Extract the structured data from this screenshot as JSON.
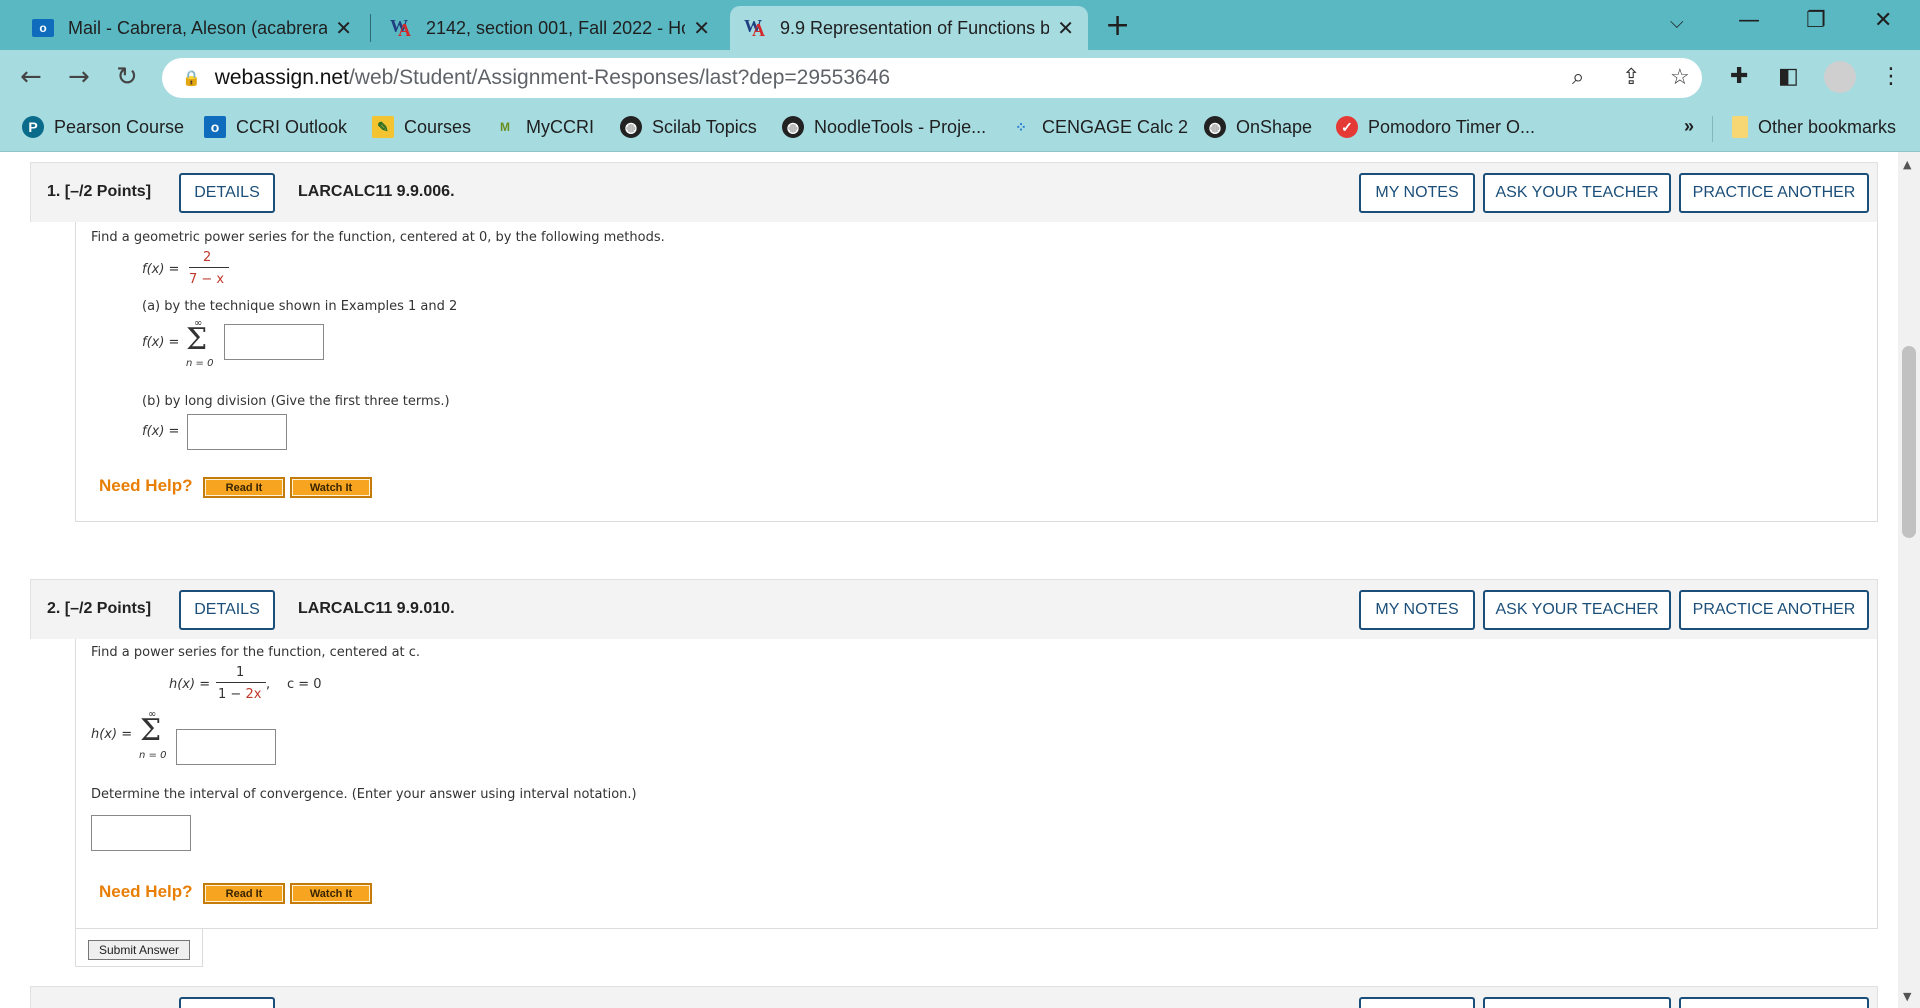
{
  "tabs": [
    {
      "title": "Mail - Cabrera, Aleson (acabrera",
      "icon": "outlook-icon"
    },
    {
      "title": "2142, section 001, Fall 2022 - Ho",
      "icon": "webassign-icon"
    },
    {
      "title": "9.9 Representation of Functions b",
      "icon": "webassign-icon",
      "active": true
    }
  ],
  "address": {
    "host": "webassign.net",
    "path": "/web/Student/Assignment-Responses/last?dep=29553646"
  },
  "bookmarks": [
    {
      "label": "Pearson Course",
      "icon": "pearson-icon"
    },
    {
      "label": "CCRI Outlook",
      "icon": "outlook-icon"
    },
    {
      "label": "Courses",
      "icon": "pencil-icon"
    },
    {
      "label": "MyCCRI",
      "icon": "myccri-icon"
    },
    {
      "label": "Scilab Topics",
      "icon": "globe-icon"
    },
    {
      "label": "NoodleTools - Proje...",
      "icon": "globe-icon"
    },
    {
      "label": "CENGAGE Calc 2",
      "icon": "cengage-icon"
    },
    {
      "label": "OnShape",
      "icon": "globe-icon"
    },
    {
      "label": "Pomodoro Timer O...",
      "icon": "check-icon"
    }
  ],
  "bookmarks_more": "»",
  "other_bookmarks": "Other bookmarks",
  "buttons": {
    "details": "DETAILS",
    "my_notes": "MY NOTES",
    "ask_teacher": "ASK YOUR TEACHER",
    "practice": "PRACTICE ANOTHER",
    "read_it": "Read It",
    "watch_it": "Watch It",
    "submit": "Submit Answer"
  },
  "need_help": "Need Help?",
  "q1": {
    "number": "1.  [–/2 Points]",
    "code": "LARCALC11 9.9.006.",
    "prompt": "Find a geometric power series for the function, centered at 0, by the following methods.",
    "fx": "f(x) =",
    "numerator": "2",
    "denominator": "7 − x",
    "part_a": "(a) by the technique shown in Examples 1 and 2",
    "sum_top": "∞",
    "sum_bottom": "n = 0",
    "part_b": "(b) by long division (Give the first three terms.)"
  },
  "q2": {
    "number": "2.  [–/2 Points]",
    "code": "LARCALC11 9.9.010.",
    "prompt": "Find a power series for the function, centered at c.",
    "hx": "h(x) =",
    "numerator": "1",
    "denominator_a": "1 − ",
    "denominator_b": "2x",
    "c_value": "c = 0",
    "sum_top": "∞",
    "sum_bottom": "n = 0",
    "interval_prompt": "Determine the interval of convergence. (Enter your answer using interval notation.)"
  }
}
